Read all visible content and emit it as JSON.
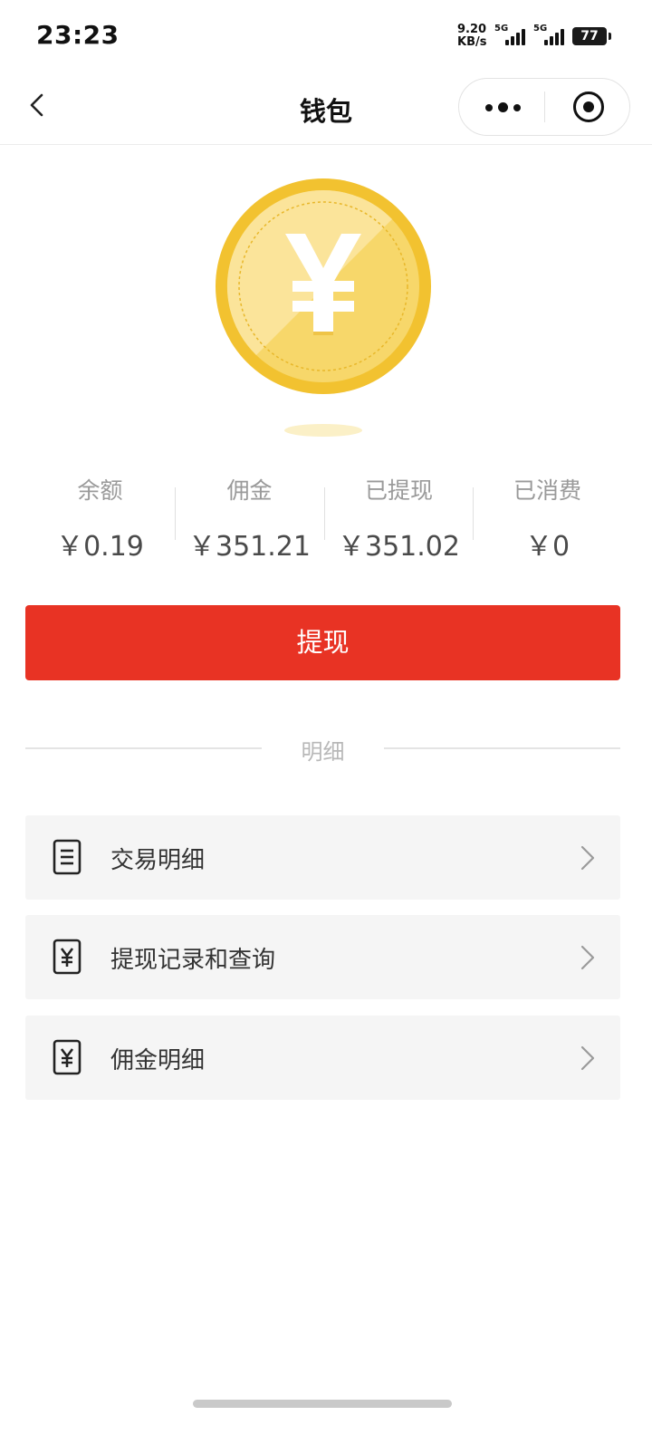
{
  "status_bar": {
    "time": "23:23",
    "net_speed_value": "9.20",
    "net_speed_unit": "KB/s",
    "signal1_label": "5G",
    "signal2_label": "5G",
    "battery": "77"
  },
  "nav": {
    "title": "钱包"
  },
  "stats": [
    {
      "label": "余额",
      "value": "￥0.19"
    },
    {
      "label": "佣金",
      "value": "￥351.21"
    },
    {
      "label": "已提现",
      "value": "￥351.02"
    },
    {
      "label": "已消费",
      "value": "￥0"
    }
  ],
  "withdraw_button": "提现",
  "section_title": "明细",
  "list": [
    {
      "label": "交易明细",
      "icon": "document-icon"
    },
    {
      "label": "提现记录和查询",
      "icon": "yen-receipt-icon"
    },
    {
      "label": "佣金明细",
      "icon": "yen-receipt-icon"
    }
  ],
  "colors": {
    "primary_red": "#e83324",
    "coin_gold": "#f2c230",
    "list_bg": "#f5f5f5"
  }
}
